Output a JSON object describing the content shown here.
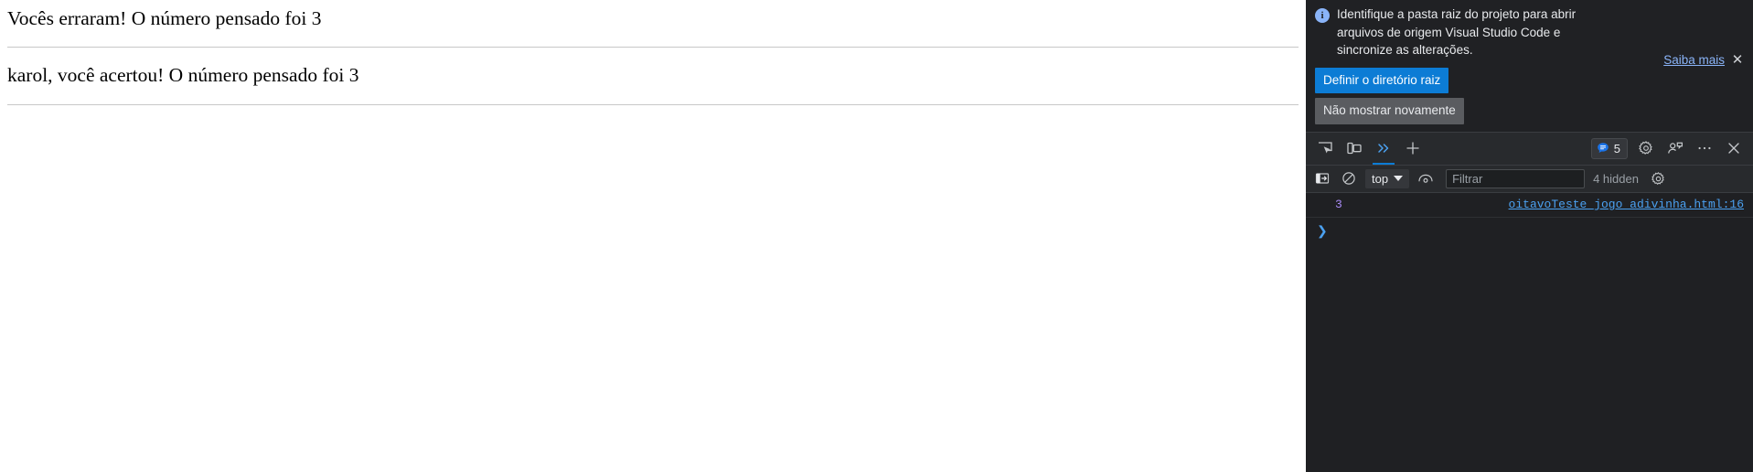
{
  "webpage": {
    "lines": [
      "Vocês erraram! O número pensado foi 3",
      "karol, você acertou! O número pensado foi 3"
    ]
  },
  "devtools": {
    "infobar": {
      "icon": "info-icon",
      "message": "Identifique a pasta raiz do projeto para abrir arquivos de origem Visual Studio Code e sincronize as alterações.",
      "learn_more_label": "Saiba mais",
      "close_label": "✕",
      "primary_button": "Definir o diretório raiz",
      "secondary_button": "Não mostrar novamente",
      "primary_color": "#0c7cd5",
      "secondary_color": "#5a5c60",
      "icon_color": "#8ab4f8",
      "link_color": "#8ab4f8"
    },
    "toolbar": {
      "inspect_icon": "inspect-element-icon",
      "device_icon": "device-toolbar-icon",
      "more_tabs_icon": "chevron-double-right-icon",
      "more_tabs_label": "»",
      "add_tab_icon": "plus-icon",
      "add_tab_label": "+",
      "issues_icon": "issues-speech-bubble-icon",
      "issues_count": "5",
      "settings_icon": "gear-icon",
      "feedback_icon": "feedback-person-icon",
      "more_options_icon": "ellipsis-icon",
      "more_options_label": "···",
      "close_icon": "close-icon",
      "close_label": "✕",
      "accent_color": "#0c7cd5"
    },
    "console_toolbar": {
      "sidebar_icon": "console-sidebar-icon",
      "clear_icon": "clear-console-icon",
      "context_label": "top",
      "context_caret": "▼",
      "live_expression_icon": "eye-icon",
      "filter_placeholder": "Filtrar",
      "filter_value": "",
      "hidden_label": "4 hidden",
      "settings_icon": "console-settings-gear-icon"
    },
    "console": {
      "entries": [
        {
          "message": "3",
          "source": "oitavoTeste_jogo_adivinha.html:16",
          "message_color": "#a98bf5",
          "source_color": "#4ba1f1"
        }
      ],
      "prompt_symbol": "❯",
      "prompt_value": ""
    }
  }
}
